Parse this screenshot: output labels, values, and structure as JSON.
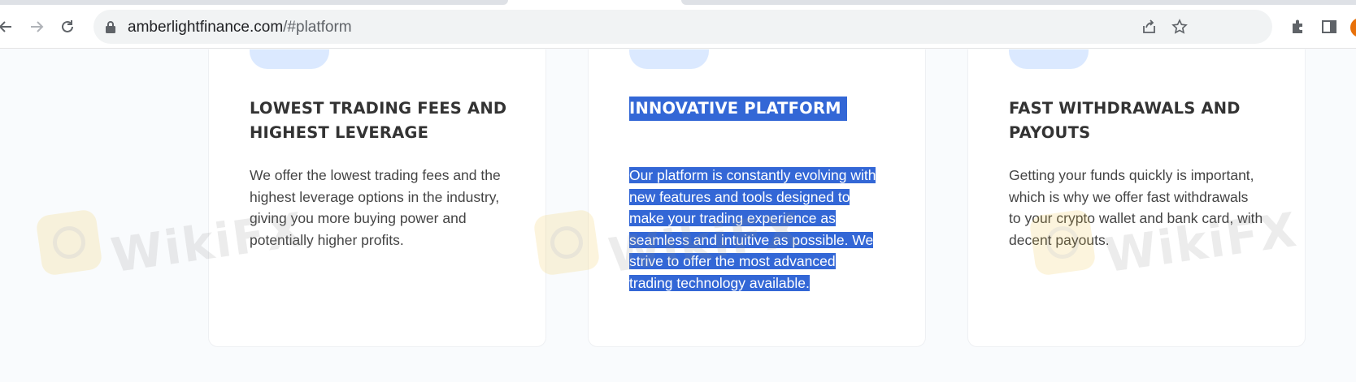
{
  "browser": {
    "url_domain": "amberlightfinance.com",
    "url_path": "/#platform",
    "icons": [
      "back-arrow-icon",
      "forward-arrow-icon",
      "reload-icon",
      "lock-icon",
      "share-icon",
      "star-icon",
      "extensions-icon",
      "side-panel-icon",
      "profile-avatar"
    ]
  },
  "features": [
    {
      "title": "LOWEST TRADING FEES AND HIGHEST LEVERAGE",
      "title_lines": [
        "LOWEST TRADING FEES AND",
        "HIGHEST LEVERAGE"
      ],
      "body_lines": [
        "We offer the lowest trading fees and the",
        "highest leverage options in the industry,",
        "giving you more buying power and",
        "potentially higher profits."
      ],
      "selected": false
    },
    {
      "title": "INNOVATIVE PLATFORM",
      "title_lines": [
        "INNOVATIVE PLATFORM"
      ],
      "body_lines": [
        "Our platform is constantly evolving with",
        "new features and tools designed to",
        "make your trading experience as",
        "seamless and intuitive as possible. We",
        "strive to offer the most advanced",
        "trading technology available."
      ],
      "selected": true
    },
    {
      "title": "FAST WITHDRAWALS AND PAYOUTS",
      "title_lines": [
        "FAST WITHDRAWALS AND",
        "PAYOUTS"
      ],
      "body_lines": [
        "Getting your funds quickly is important,",
        "which is why we offer fast withdrawals",
        "to your crypto wallet and bank card, with",
        "decent payouts."
      ],
      "selected": false
    }
  ],
  "watermark": {
    "text": "WikiFX"
  },
  "colors": {
    "selection": "#3367d6",
    "icon_box": "#dbe9ff",
    "heading": "#333333",
    "body_text": "#444444",
    "page_bg": "#f9fbfd"
  }
}
